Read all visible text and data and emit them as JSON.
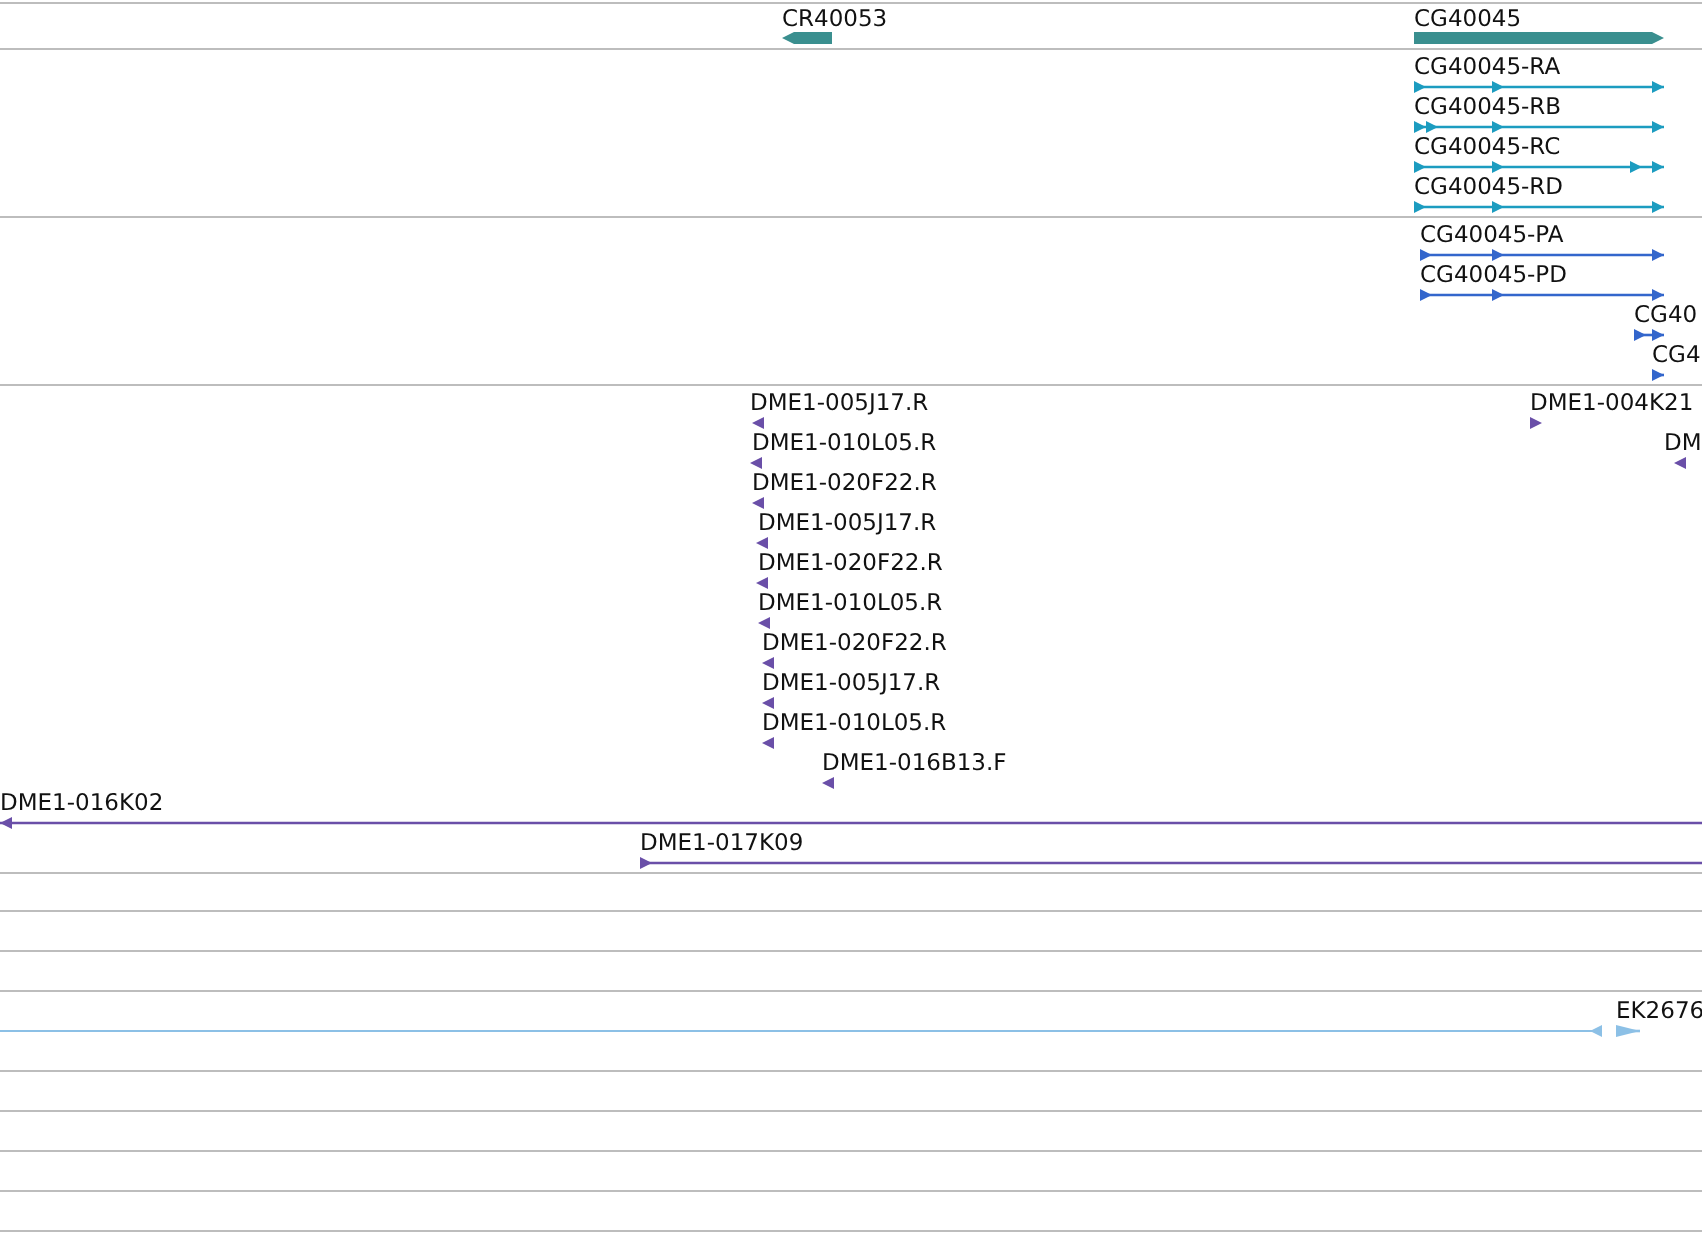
{
  "tracks": [
    {
      "kind": "gene",
      "features": [
        {
          "label": "CR40053",
          "reverse": true
        },
        {
          "label": "CG40045",
          "reverse": false
        }
      ]
    },
    {
      "kind": "transcript",
      "features": [
        {
          "label": "CG40045-RA",
          "reverse": false
        },
        {
          "label": "CG40045-RB",
          "reverse": false
        },
        {
          "label": "CG40045-RC",
          "reverse": false
        },
        {
          "label": "CG40045-RD",
          "reverse": false
        }
      ]
    },
    {
      "kind": "protein",
      "features": [
        {
          "label": "CG40045-PA",
          "reverse": false
        },
        {
          "label": "CG40045-PD",
          "reverse": false
        },
        {
          "label": "CG40",
          "reverse": false
        },
        {
          "label": "CG4",
          "reverse": false
        }
      ]
    },
    {
      "kind": "est",
      "features": [
        {
          "label": "DME1-005J17.R",
          "reverse": true
        },
        {
          "label": "DME1-010L05.R",
          "reverse": true
        },
        {
          "label": "DME1-020F22.R",
          "reverse": true
        },
        {
          "label": "DME1-005J17.R",
          "reverse": true
        },
        {
          "label": "DME1-020F22.R",
          "reverse": true
        },
        {
          "label": "DME1-010L05.R",
          "reverse": true
        },
        {
          "label": "DME1-020F22.R",
          "reverse": true
        },
        {
          "label": "DME1-005J17.R",
          "reverse": true
        },
        {
          "label": "DME1-010L05.R",
          "reverse": true
        },
        {
          "label": "DME1-016B13.F",
          "reverse": true
        },
        {
          "label": "DME1-004K21",
          "reverse": false
        },
        {
          "label": "DM",
          "reverse": true
        },
        {
          "label": "DME1-016K02",
          "reverse": true
        },
        {
          "label": "DME1-017K09",
          "reverse": false
        }
      ]
    },
    {
      "kind": "cdna",
      "features": [
        {
          "label": "EK2676",
          "reverse": false
        }
      ]
    }
  ]
}
